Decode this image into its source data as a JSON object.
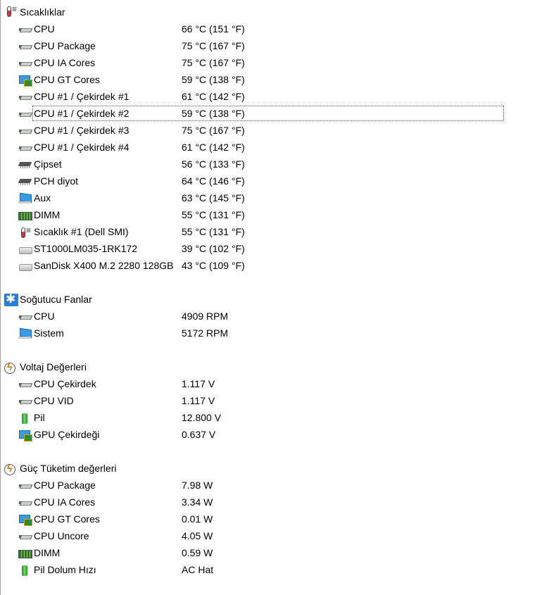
{
  "sections": [
    {
      "title": "Sıcaklıklar",
      "icon": "thermometer-icon",
      "items": [
        {
          "label": "CPU",
          "value": "66 °C  (151 °F)",
          "icon": "cpu-icon"
        },
        {
          "label": "CPU Package",
          "value": "75 °C  (167 °F)",
          "icon": "cpu-icon"
        },
        {
          "label": "CPU IA Cores",
          "value": "75 °C  (167 °F)",
          "icon": "cpu-icon"
        },
        {
          "label": "CPU GT Cores",
          "value": "59 °C  (138 °F)",
          "icon": "gpu-icon"
        },
        {
          "label": "CPU #1 / Çekirdek #1",
          "value": "61 °C  (142 °F)",
          "icon": "cpu-icon"
        },
        {
          "label": "CPU #1 / Çekirdek #2",
          "value": "59 °C  (138 °F)",
          "icon": "cpu-icon",
          "selected": true
        },
        {
          "label": "CPU #1 / Çekirdek #3",
          "value": "75 °C  (167 °F)",
          "icon": "cpu-icon"
        },
        {
          "label": "CPU #1 / Çekirdek #4",
          "value": "61 °C  (142 °F)",
          "icon": "cpu-icon"
        },
        {
          "label": "Çipset",
          "value": "56 °C  (133 °F)",
          "icon": "chip-icon"
        },
        {
          "label": "PCH diyot",
          "value": "64 °C  (146 °F)",
          "icon": "chip-icon"
        },
        {
          "label": "Aux",
          "value": "63 °C  (145 °F)",
          "icon": "monitor-icon"
        },
        {
          "label": "DIMM",
          "value": "55 °C  (131 °F)",
          "icon": "dimm-icon"
        },
        {
          "label": "Sıcaklık #1 (Dell SMI)",
          "value": "55 °C  (131 °F)",
          "icon": "thermometer-icon"
        },
        {
          "label": "ST1000LM035-1RK172",
          "value": "39 °C  (102 °F)",
          "icon": "hdd-icon"
        },
        {
          "label": "SanDisk X400 M.2 2280 128GB",
          "value": "43 °C  (109 °F)",
          "icon": "hdd-icon"
        }
      ]
    },
    {
      "title": "Soğutucu Fanlar",
      "icon": "fan-icon",
      "items": [
        {
          "label": "CPU",
          "value": "4909 RPM",
          "icon": "cpu-icon"
        },
        {
          "label": "Sistem",
          "value": "5172 RPM",
          "icon": "monitor-icon"
        }
      ]
    },
    {
      "title": "Voltaj Değerleri",
      "icon": "voltage-icon",
      "items": [
        {
          "label": "CPU Çekirdek",
          "value": "1.117 V",
          "icon": "cpu-icon"
        },
        {
          "label": "CPU VID",
          "value": "1.117 V",
          "icon": "cpu-icon"
        },
        {
          "label": "Pil",
          "value": "12.800 V",
          "icon": "battery-icon"
        },
        {
          "label": "GPU Çekirdeği",
          "value": "0.637 V",
          "icon": "gpu-icon"
        }
      ]
    },
    {
      "title": "Güç Tüketim değerleri",
      "icon": "voltage-icon",
      "items": [
        {
          "label": "CPU Package",
          "value": "7.98 W",
          "icon": "cpu-icon"
        },
        {
          "label": "CPU IA Cores",
          "value": "3.34 W",
          "icon": "cpu-icon"
        },
        {
          "label": "CPU GT Cores",
          "value": "0.01 W",
          "icon": "gpu-icon"
        },
        {
          "label": "CPU Uncore",
          "value": "4.05 W",
          "icon": "cpu-icon"
        },
        {
          "label": "DIMM",
          "value": "0.59 W",
          "icon": "dimm-icon"
        },
        {
          "label": "Pil Dolum Hızı",
          "value": "AC Hat",
          "icon": "battery-icon"
        }
      ]
    }
  ]
}
